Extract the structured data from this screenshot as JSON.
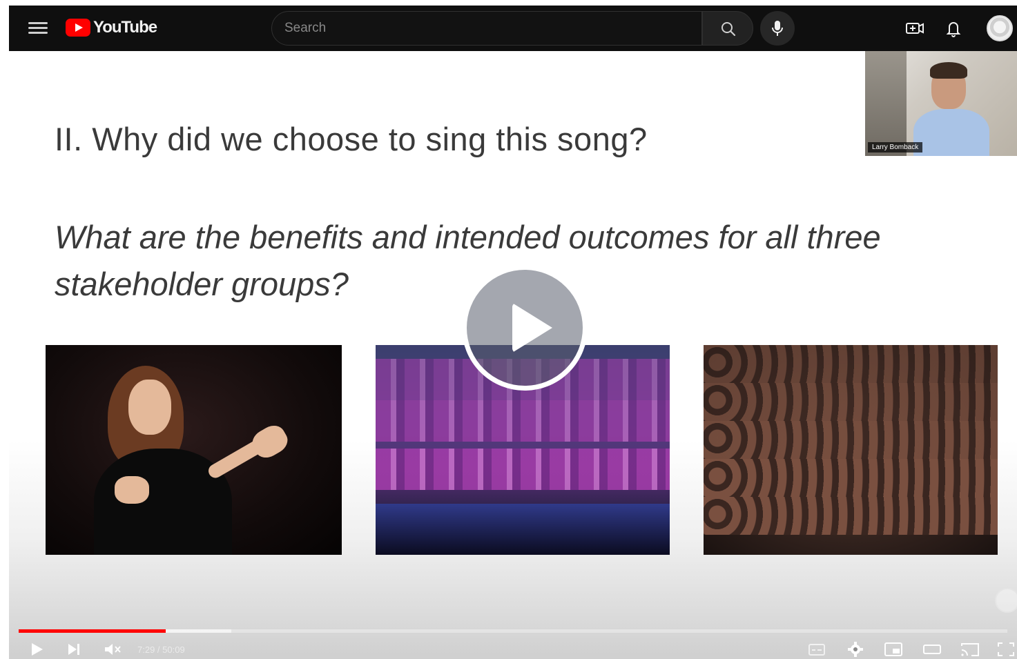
{
  "app": {
    "logo_text": "YouTube"
  },
  "search": {
    "placeholder": "Search"
  },
  "slide": {
    "title": "II. Why did we choose to sing this song?",
    "subtitle": "What are the benefits and intended outcomes for all three stakeholder groups?"
  },
  "webcam": {
    "name_label": "Larry Bomback"
  },
  "player": {
    "time_display": "7:29 / 50:09",
    "progress_fraction": 0.149,
    "buffer_fraction": 0.215,
    "played_color": "#ff0000"
  },
  "colors": {
    "topbar_bg": "#0f0f0f",
    "brand_red": "#ff0000"
  },
  "icons": {
    "menu": "hamburger-icon",
    "search": "search-icon",
    "mic": "mic-icon",
    "create": "create-video-icon",
    "notifications": "bell-icon",
    "play_large": "play-icon",
    "play": "play-icon",
    "next": "skip-next-icon",
    "volume": "muted-icon",
    "captions": "captions-icon",
    "settings": "gear-icon",
    "miniplayer": "miniplayer-icon",
    "theater": "theater-icon",
    "cast": "cast-icon",
    "fullscreen": "fullscreen-icon"
  }
}
